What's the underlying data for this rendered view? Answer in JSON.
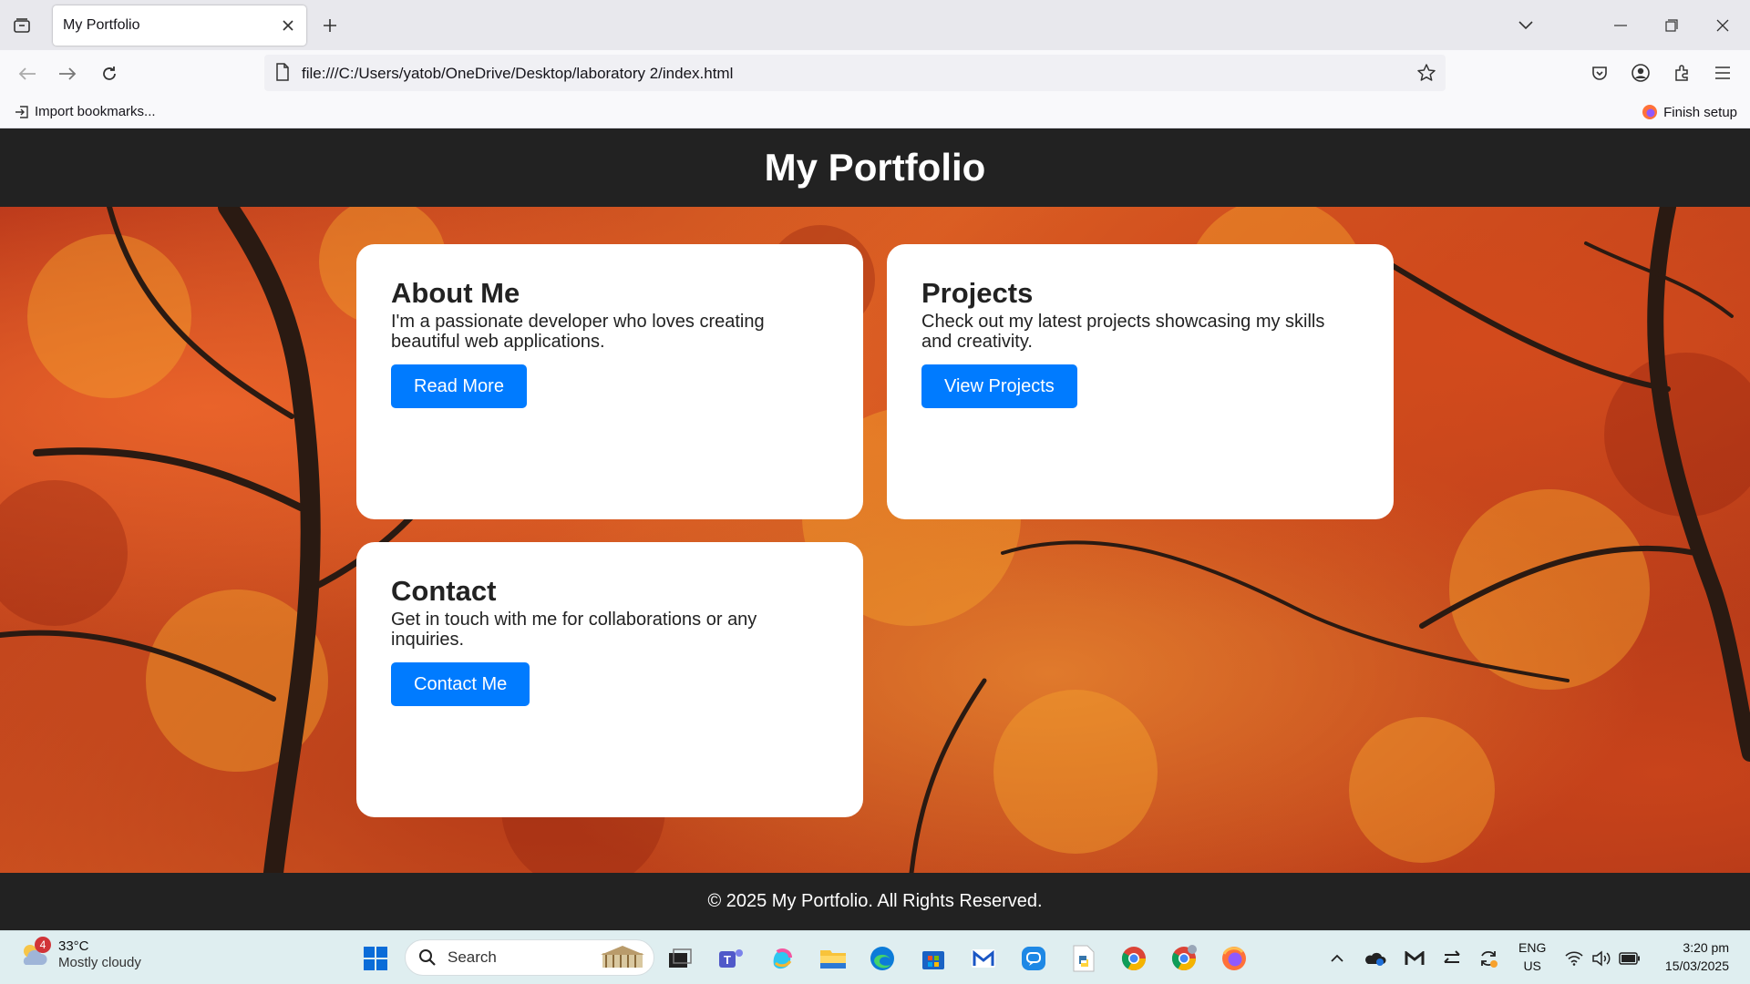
{
  "browser": {
    "tab_title": "My Portfolio",
    "url": "file:///C:/Users/yatob/OneDrive/Desktop/laboratory 2/index.html",
    "bookmark_import": "Import bookmarks...",
    "finish_setup": "Finish setup"
  },
  "site": {
    "header_title": "My Portfolio",
    "cards": [
      {
        "title": "About Me",
        "text": "I'm a passionate developer who loves creating beautiful web applications.",
        "button": "Read More"
      },
      {
        "title": "Projects",
        "text": "Check out my latest projects showcasing my skills and creativity.",
        "button": "View Projects"
      },
      {
        "title": "Contact",
        "text": "Get in touch with me for collaborations or any inquiries.",
        "button": "Contact Me"
      }
    ],
    "footer": "© 2025 My Portfolio. All Rights Reserved."
  },
  "taskbar": {
    "weather_badge": "4",
    "temperature": "33°C",
    "weather_desc": "Mostly cloudy",
    "search_label": "Search",
    "lang_top": "ENG",
    "lang_bottom": "US",
    "time": "3:20 pm",
    "date": "15/03/2025"
  },
  "colors": {
    "header_bg": "#222222",
    "button_blue": "#007bff",
    "card_bg": "#ffffff"
  }
}
